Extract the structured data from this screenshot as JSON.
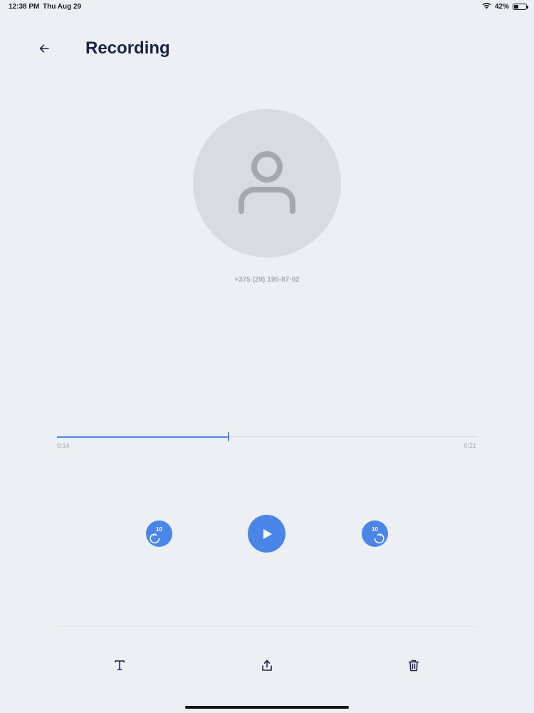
{
  "status_bar": {
    "time": "12:38 PM",
    "date": "Thu Aug 29",
    "battery_percent": "42%",
    "battery_level": 0.42
  },
  "header": {
    "title": "Recording",
    "back_icon": "arrow-left-icon"
  },
  "contact": {
    "avatar_icon": "person-icon",
    "phone_number": "+375 (29) 195-87-92"
  },
  "player": {
    "current_time": "0:14",
    "total_time": "0:21",
    "progress": 0.41,
    "skip_back_label": "10",
    "skip_forward_label": "10",
    "accent_color": "#4A86E8"
  },
  "toolbar": {
    "text_icon": "text-icon",
    "share_icon": "share-icon",
    "delete_icon": "trash-icon"
  }
}
